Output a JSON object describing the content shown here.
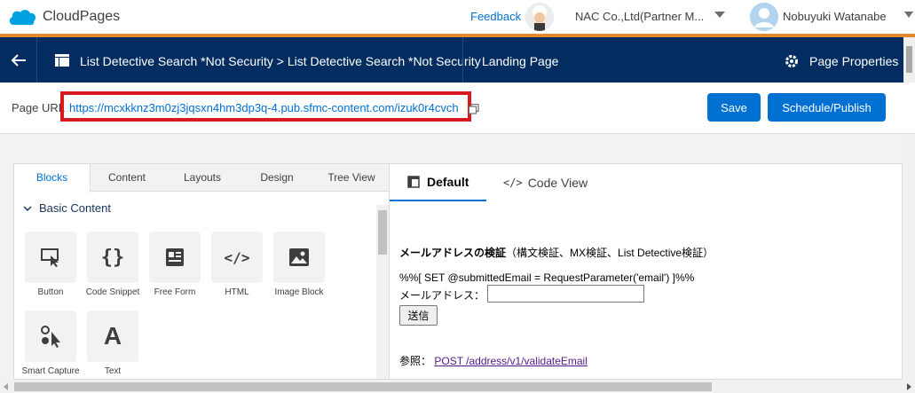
{
  "topbar": {
    "brand_name": "CloudPages",
    "feedback_label": "Feedback",
    "org_name": "NAC Co.,Ltd(Partner M...",
    "user_name": "Nobuyuki Watanabe"
  },
  "navbar": {
    "breadcrumb": "List Detective Search *Not Security > List Detective Search *Not Security",
    "landing_label": "Landing Page",
    "page_properties_label": "Page Properties"
  },
  "urlbar": {
    "label": "Page URL",
    "url": "https://mcxkknz3m0zj3jqsxn4hm3dp3q-4.pub.sfmc-content.com/izuk0r4cvch",
    "save_label": "Save",
    "publish_label": "Schedule/Publish"
  },
  "left_panel": {
    "tabs": [
      "Blocks",
      "Content",
      "Layouts",
      "Design",
      "Tree View"
    ],
    "active_tab": "Blocks",
    "section_title": "Basic Content",
    "blocks": [
      {
        "label": "Button",
        "icon": "button-icon"
      },
      {
        "label": "Code Snippet",
        "icon": "code-snippet-icon"
      },
      {
        "label": "Free Form",
        "icon": "free-form-icon"
      },
      {
        "label": "HTML",
        "icon": "html-icon"
      },
      {
        "label": "Image Block",
        "icon": "image-block-icon"
      },
      {
        "label": "Smart Capture",
        "icon": "smart-capture-icon"
      },
      {
        "label": "Text",
        "icon": "text-icon"
      }
    ]
  },
  "right_panel": {
    "tabs": [
      "Default",
      "Code View"
    ],
    "active_tab": "Default",
    "preview": {
      "title_bold": "メールアドレスの検証",
      "title_rest": "（構文検証、MX検証、List Detective検証）",
      "code_line": "%%[ SET @submittedEmail = RequestParameter('email') ]%%",
      "email_label": "メールアドレス：",
      "email_value": "",
      "submit_label": "送信",
      "ref_label": "参照：",
      "ref_link": "POST /address/v1/validateEmail"
    }
  },
  "colors": {
    "nav_bg": "#032d60",
    "accent": "#0070d2",
    "highlight_border": "#d71921",
    "orange_line": "#e08a2c"
  }
}
